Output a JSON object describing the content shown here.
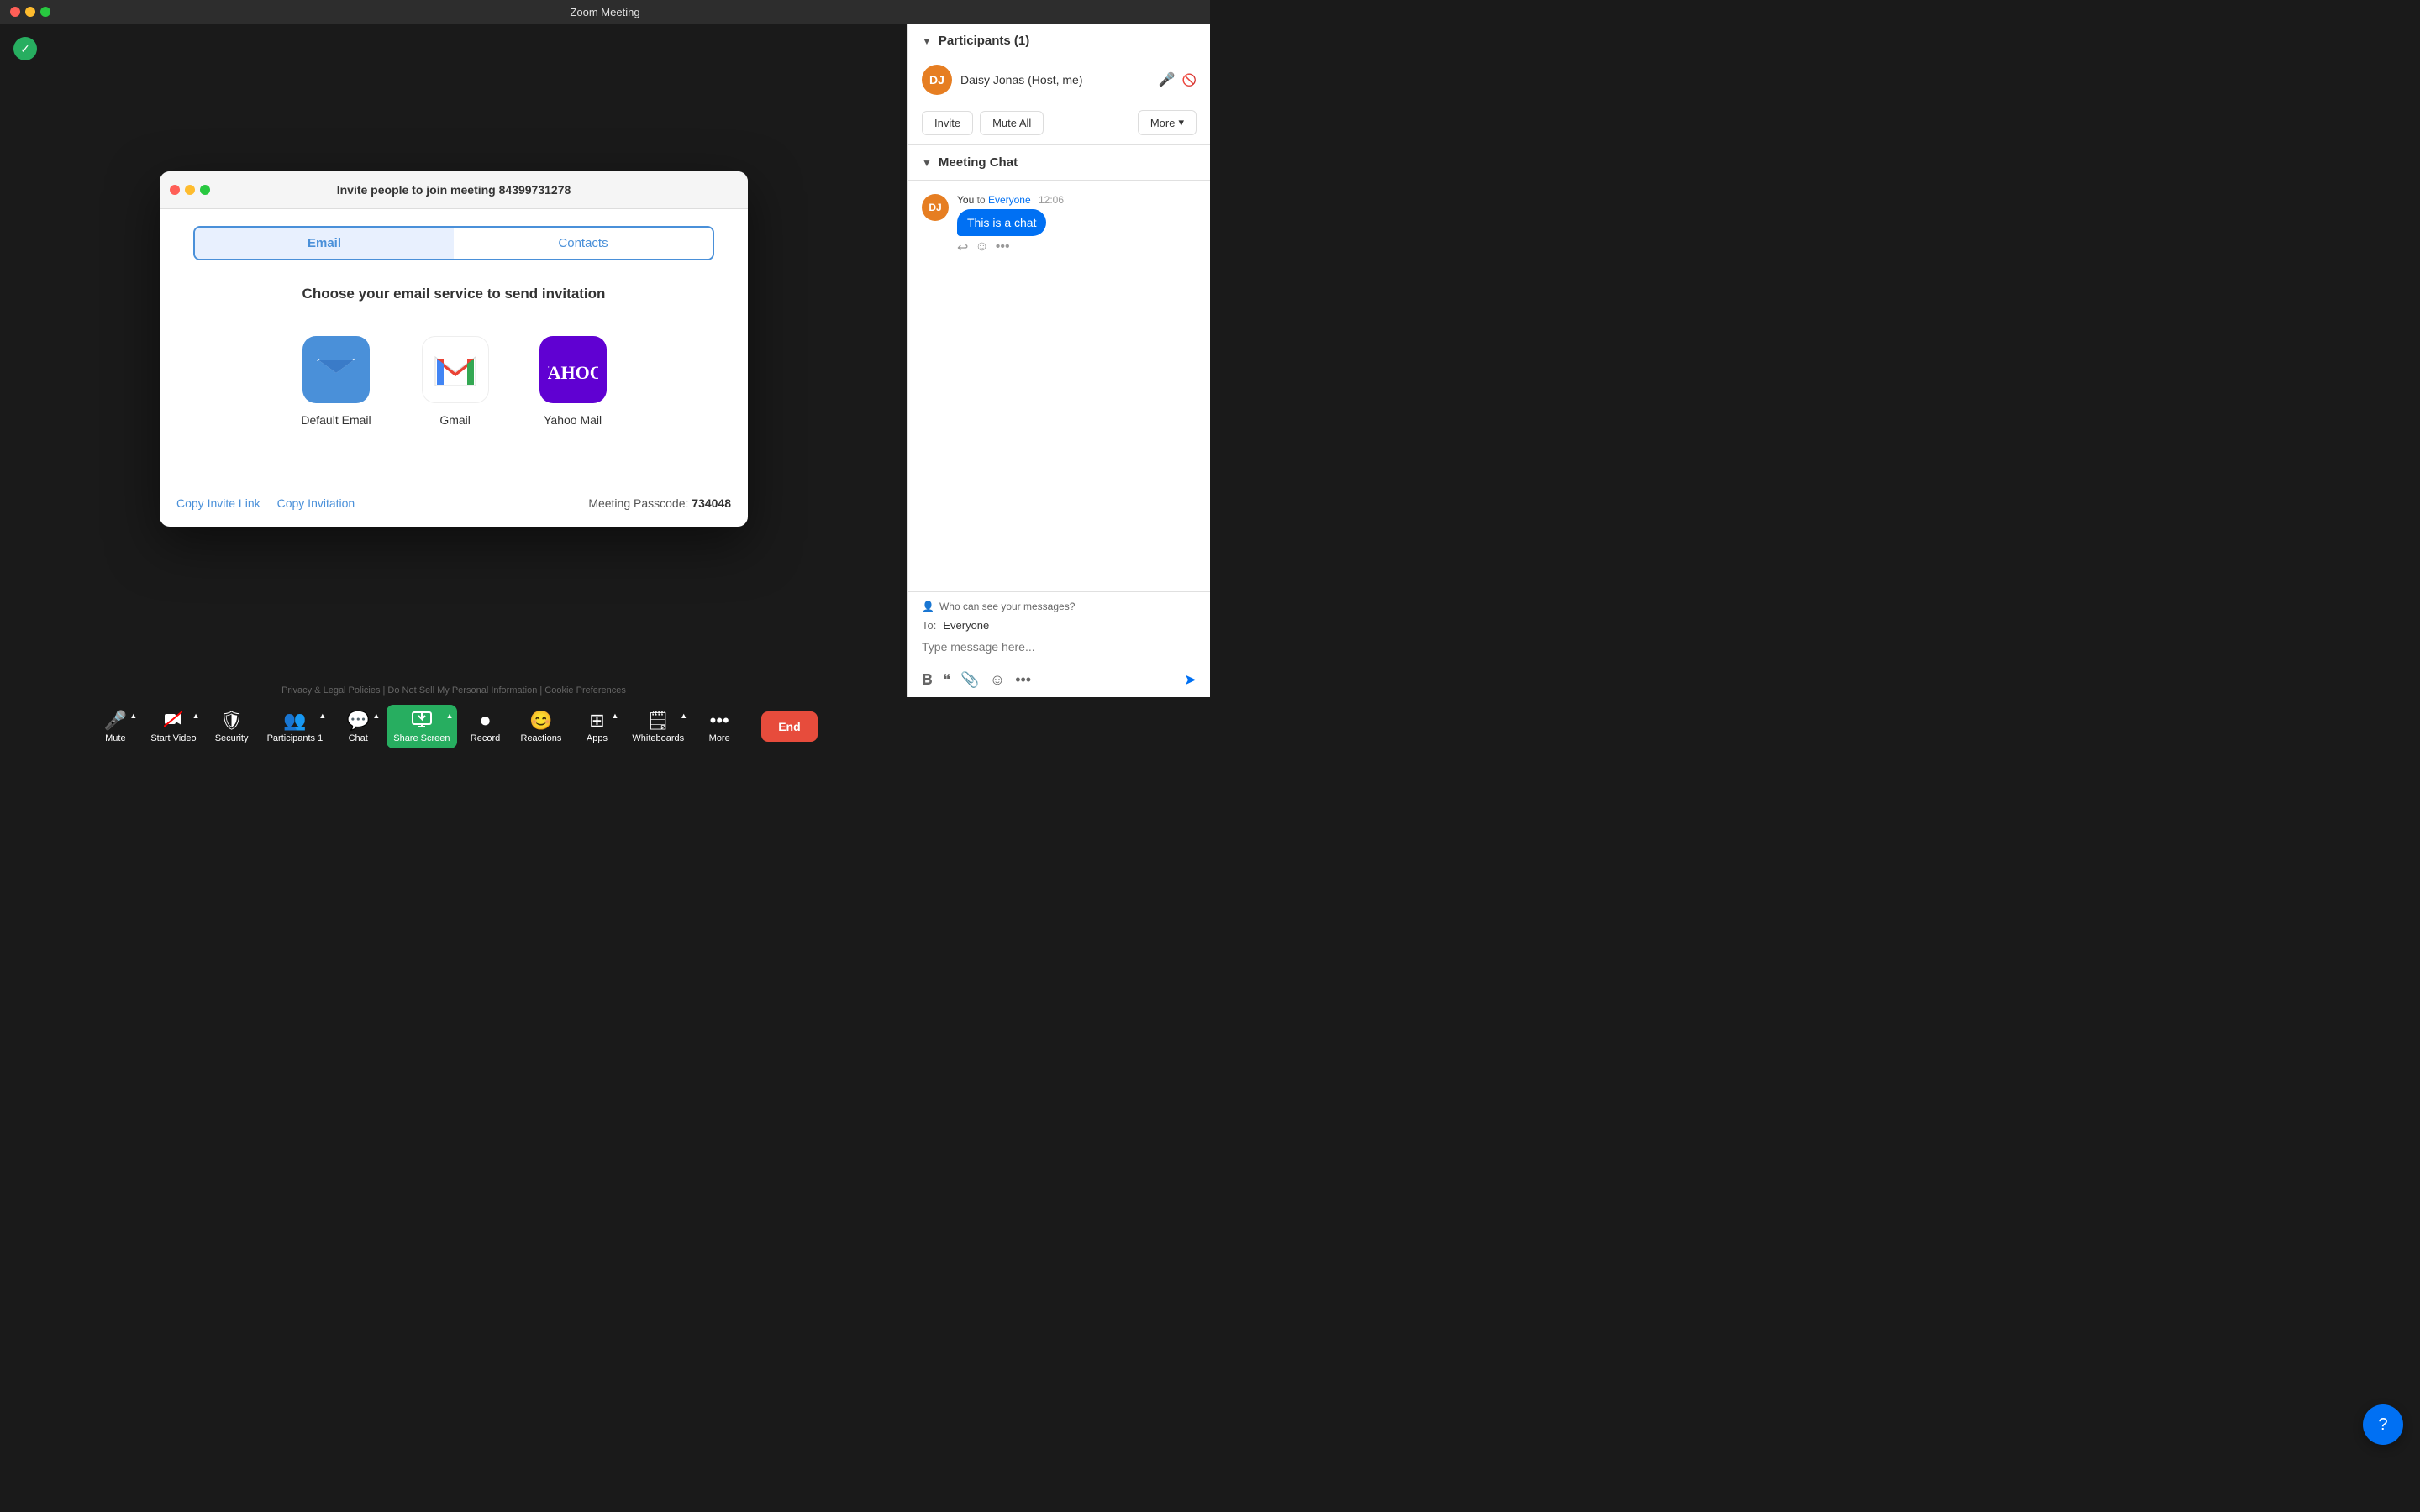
{
  "titleBar": {
    "title": "Zoom Meeting",
    "controls": {
      "close": "×",
      "minimize": "−",
      "maximize": "+"
    }
  },
  "shieldIcon": "✓",
  "userLabel": "Daisy Jonas",
  "rightSidebar": {
    "participants": {
      "title": "Participants (1)",
      "collapseIcon": "▼",
      "participant": {
        "initials": "DJ",
        "name": "Daisy Jonas (Host, me)"
      },
      "actions": {
        "invite": "Invite",
        "muteAll": "Mute All",
        "more": "More",
        "moreIcon": "▾"
      }
    },
    "chat": {
      "title": "Meeting Chat",
      "collapseIcon": "▼",
      "messages": [
        {
          "senderInitials": "DJ",
          "sender": "You",
          "toLabel": "to",
          "toEveryone": "Everyone",
          "time": "12:06",
          "text": "This is a chat"
        }
      ],
      "messageActions": {
        "reply": "↩",
        "react": "☺",
        "more": "•••"
      },
      "input": {
        "to": "To: Everyone",
        "toLabel": "To:",
        "toValue": "Everyone",
        "placeholder": "Type message here...",
        "visibility": "Who can see your messages?"
      },
      "toolbarIcons": {
        "bold": "B",
        "emoji": "☺",
        "attachment": "📎",
        "more": "•••",
        "send": "➤"
      }
    }
  },
  "toolbar": {
    "items": [
      {
        "id": "mute",
        "icon": "🎤",
        "label": "Mute",
        "hasArrow": true
      },
      {
        "id": "start-video",
        "icon": "📷",
        "label": "Start Video",
        "hasArrow": true,
        "slashed": true
      },
      {
        "id": "security",
        "icon": "🛡",
        "label": "Security"
      },
      {
        "id": "participants",
        "icon": "👥",
        "label": "Participants",
        "badge": "1",
        "hasArrow": true
      },
      {
        "id": "chat",
        "icon": "💬",
        "label": "Chat",
        "hasArrow": true
      },
      {
        "id": "share-screen",
        "icon": "↑",
        "label": "Share Screen",
        "active": true,
        "hasArrow": true
      },
      {
        "id": "record",
        "icon": "⏺",
        "label": "Record"
      },
      {
        "id": "reactions",
        "icon": "😊",
        "label": "Reactions"
      },
      {
        "id": "apps",
        "icon": "🔲",
        "label": "Apps",
        "hasArrow": true
      },
      {
        "id": "whiteboards",
        "icon": "⬜",
        "label": "Whiteboards",
        "hasArrow": true
      },
      {
        "id": "more",
        "icon": "•••",
        "label": "More"
      }
    ],
    "endButton": "End"
  },
  "modal": {
    "title": "Invite people to join meeting 84399731278",
    "tabs": [
      {
        "id": "email",
        "label": "Email",
        "active": true
      },
      {
        "id": "contacts",
        "label": "Contacts",
        "active": false
      }
    ],
    "body": {
      "subtitle": "Choose your email service to send invitation",
      "services": [
        {
          "id": "default-email",
          "name": "Default Email",
          "type": "default"
        },
        {
          "id": "gmail",
          "name": "Gmail",
          "type": "gmail"
        },
        {
          "id": "yahoo-mail",
          "name": "Yahoo Mail",
          "type": "yahoo"
        }
      ]
    },
    "footer": {
      "copyInviteLink": "Copy Invite Link",
      "copyInvitation": "Copy Invitation",
      "passcodeLabel": "Meeting Passcode:",
      "passcode": "734048"
    }
  },
  "helpButton": "?",
  "footerLegal": "Privacy & Legal Policies | Do Not Sell My Personal Information | Cookie Preferences"
}
